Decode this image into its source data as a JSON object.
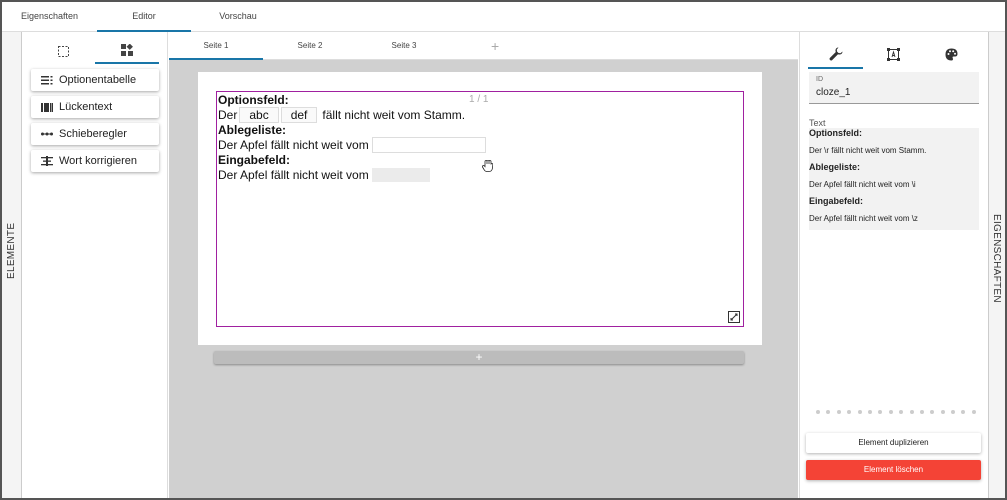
{
  "top_tabs": [
    {
      "label": "Eigenschaften"
    },
    {
      "label": "Editor"
    },
    {
      "label": "Vorschau"
    }
  ],
  "side_labels": {
    "left": "ELEMENTE",
    "right": "EIGENSCHAFTEN"
  },
  "element_buttons": [
    {
      "label": "Optionentabelle",
      "icon": "table-rows-icon"
    },
    {
      "label": "Lückentext",
      "icon": "cloze-text-icon"
    },
    {
      "label": "Schieberegler",
      "icon": "slider-icon"
    },
    {
      "label": "Wort korrigieren",
      "icon": "word-correct-icon"
    }
  ],
  "page_tabs": [
    {
      "label": "Seite 1"
    },
    {
      "label": "Seite 2"
    },
    {
      "label": "Seite 3"
    }
  ],
  "add_page_symbol": "+",
  "canvas": {
    "page_indicator": "1 / 1",
    "add_section_symbol": "+",
    "cloze": {
      "heading1": "Optionsfeld:",
      "line1_prefix": "Der",
      "options": [
        "abc",
        "def"
      ],
      "line1_suffix": "fällt nicht weit vom Stamm.",
      "heading2": "Ablegeliste:",
      "line2_prefix": "Der Apfel fällt nicht weit vom",
      "heading3": "Eingabefeld:",
      "line3_prefix": "Der Apfel fällt nicht weit vom"
    }
  },
  "properties": {
    "id_label": "ID",
    "id_value": "cloze_1",
    "text_label": "Text",
    "text_lines": [
      {
        "text": "Optionsfeld:",
        "bold": true
      },
      {
        "text": "Der \\r fällt nicht weit vom Stamm.",
        "bold": false
      },
      {
        "text": "Ablegeliste:",
        "bold": true
      },
      {
        "text": "Der Apfel fällt nicht weit vom \\i",
        "bold": false
      },
      {
        "text": "Eingabefeld:",
        "bold": true
      },
      {
        "text": "Der Apfel fällt nicht weit vom \\z",
        "bold": false
      }
    ],
    "duplicate_label": "Element duplizieren",
    "delete_label": "Element löschen"
  },
  "colors": {
    "accent": "#1976a8",
    "delete": "#f44336",
    "selection": "#a020a0"
  }
}
